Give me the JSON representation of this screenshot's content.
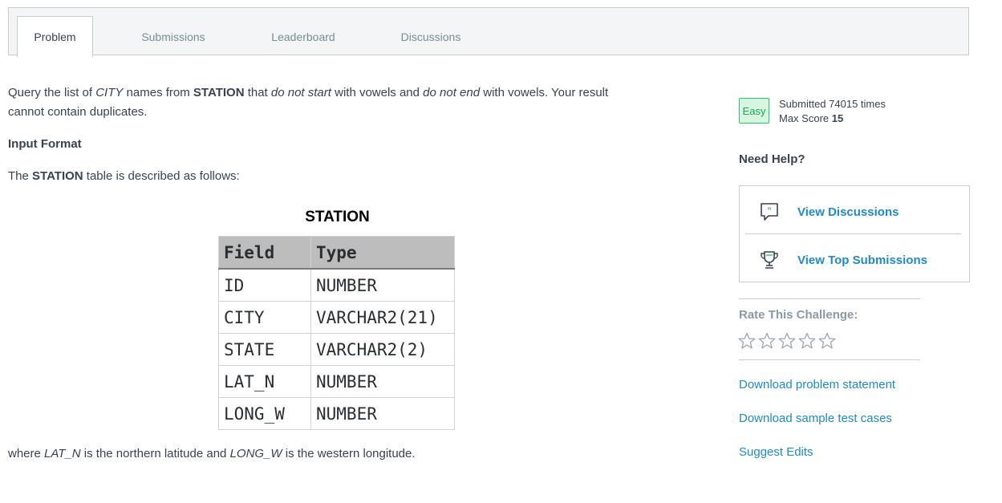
{
  "tabs": [
    {
      "label": "Problem",
      "active": true
    },
    {
      "label": "Submissions",
      "active": false
    },
    {
      "label": "Leaderboard",
      "active": false
    },
    {
      "label": "Discussions",
      "active": false
    }
  ],
  "problem": {
    "p1": [
      "Query the list of ",
      "CITY",
      " names from ",
      "STATION",
      " that ",
      "do not start",
      " with vowels and ",
      "do not end",
      " with vowels. Your result"
    ],
    "p1_line2": "cannot contain duplicates.",
    "input_format_heading": "Input Format",
    "p2": [
      "The ",
      "STATION",
      " table is described as follows:"
    ],
    "p3": [
      "where ",
      "LAT_N",
      " is the northern latitude and ",
      "LONG_W",
      " is the western longitude."
    ]
  },
  "station_table": {
    "title": "STATION",
    "headers": [
      "Field",
      "Type"
    ],
    "rows": [
      [
        "ID",
        "NUMBER"
      ],
      [
        "CITY",
        "VARCHAR2(21)"
      ],
      [
        "STATE",
        "VARCHAR2(2)"
      ],
      [
        "LAT_N",
        "NUMBER"
      ],
      [
        "LONG_W",
        "NUMBER"
      ]
    ]
  },
  "sidebar": {
    "difficulty": "Easy",
    "submitted_text": "Submitted 74015 times",
    "max_score_label": "Max Score ",
    "max_score_value": "15",
    "need_help": "Need Help?",
    "view_discussions": "View Discussions",
    "view_top_submissions": "View Top Submissions",
    "rate_title": "Rate This Challenge:",
    "rating_value": 0,
    "rating_max": 5,
    "download_statement": "Download problem statement",
    "download_tests": "Download sample test cases",
    "suggest_edits": "Suggest Edits",
    "icons": [
      "chat-quote-icon",
      "trophy-icon",
      "star-outline-icon"
    ]
  },
  "colors": {
    "link": "#1f8acb",
    "easy_green": "#2ec866",
    "text": "#39424e",
    "muted": "#8c9aa5"
  }
}
